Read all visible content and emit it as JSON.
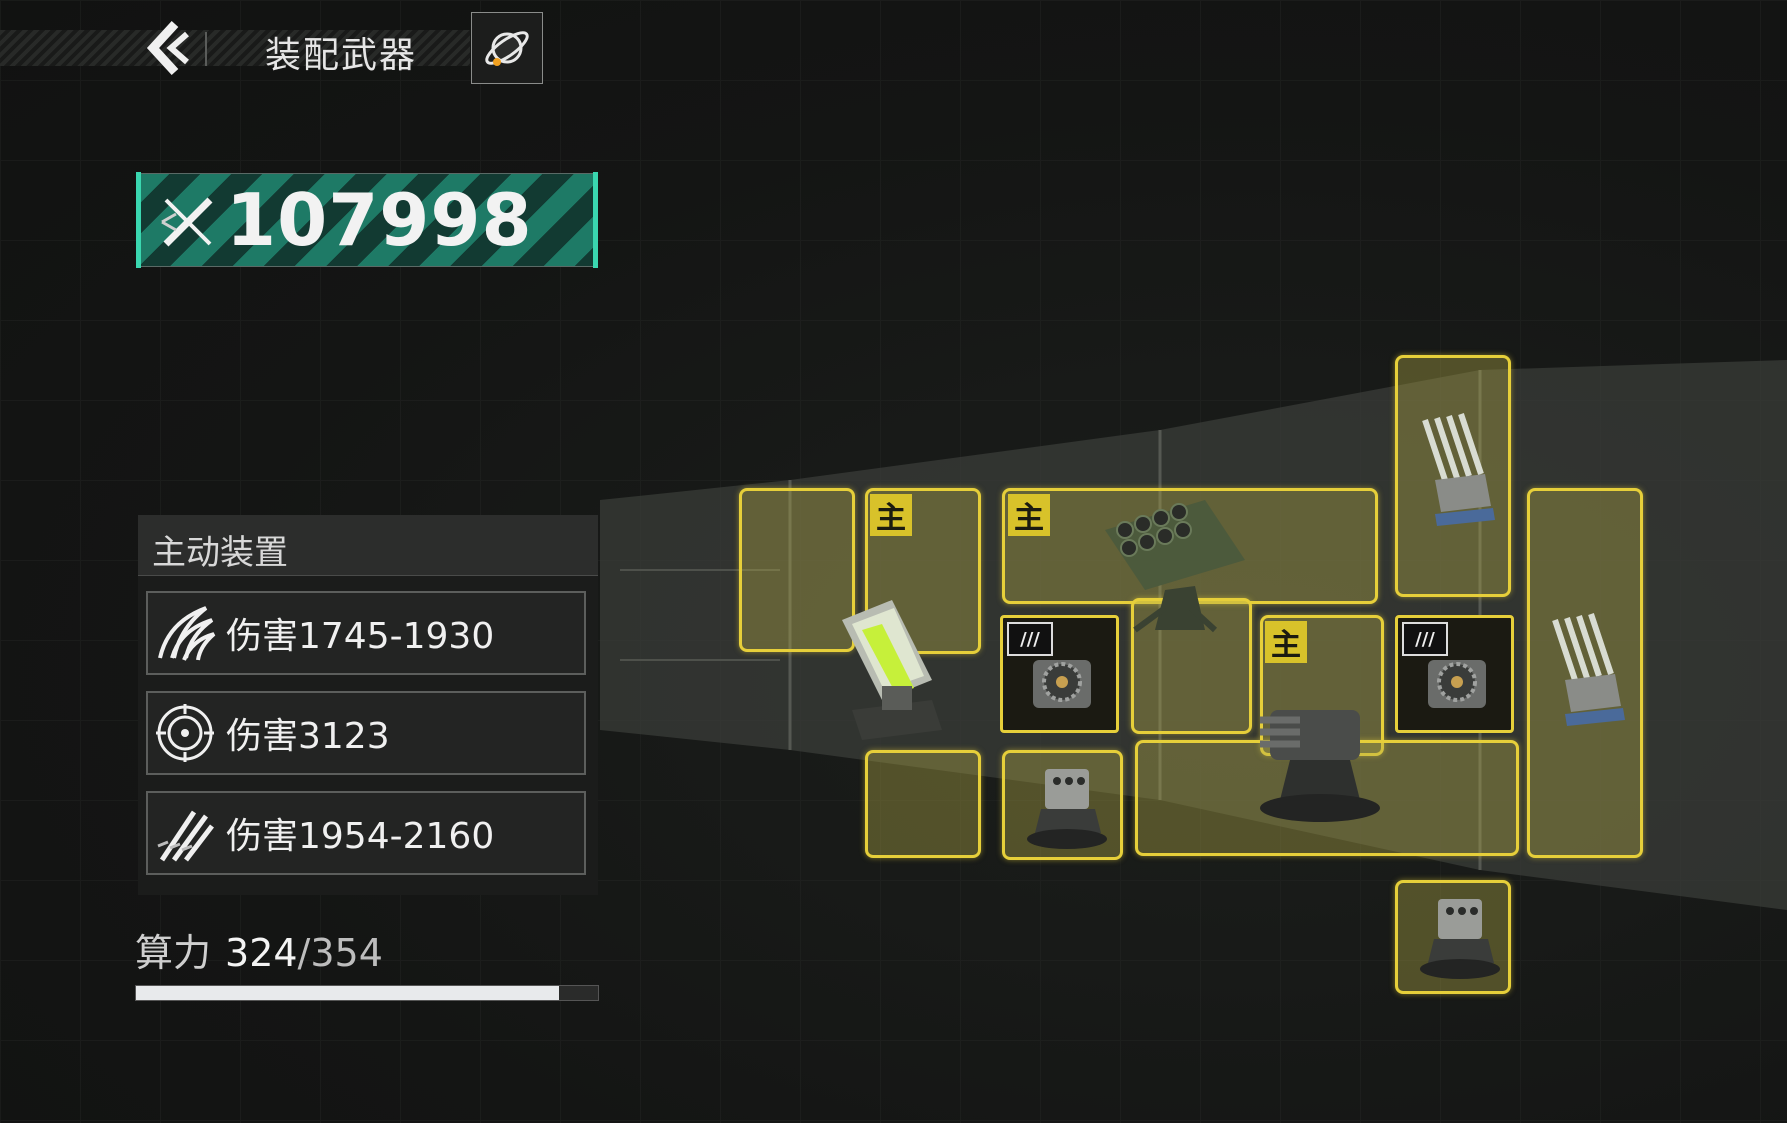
{
  "header": {
    "title": "装配武器"
  },
  "combat_power": {
    "value": "107998"
  },
  "active_devices": {
    "title": "主动装置",
    "stats": [
      {
        "icon": "claw-strike-icon",
        "label": "伤害1745-1930"
      },
      {
        "icon": "shield-burst-icon",
        "label": "伤害3123"
      },
      {
        "icon": "missile-volley-icon",
        "label": "伤害1954-2160"
      }
    ]
  },
  "compute": {
    "label": "算力",
    "current": "324",
    "max": "/354",
    "fraction": 0.915
  },
  "slots": {
    "main_badge": "主",
    "chip_tag": "///"
  },
  "colors": {
    "accent_teal": "#3ad7b0",
    "slot_yellow": "#e6cf3a"
  }
}
